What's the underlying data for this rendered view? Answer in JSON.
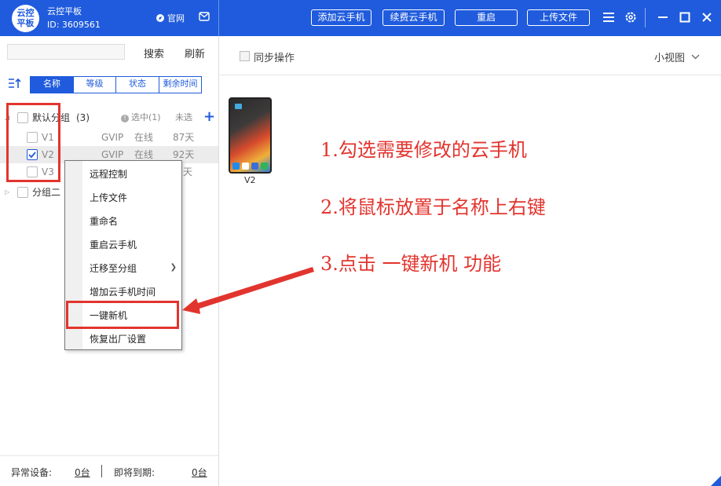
{
  "titlebar": {
    "logo_text": "云控\n平板",
    "app_name": "云控平板",
    "app_id": "ID: 3609561",
    "official_label": "官网",
    "buttons": [
      "添加云手机",
      "续费云手机",
      "重启",
      "上传文件"
    ]
  },
  "left_panel": {
    "search_label": "搜索",
    "refresh_label": "刷新",
    "tabs": [
      "名称",
      "等级",
      "状态",
      "剩余时间"
    ],
    "groups": [
      {
        "name": "默认分组",
        "count": "(3)",
        "selected_label": "选中(1)",
        "unselected_label": "未选",
        "devices": [
          {
            "name": "V1",
            "level": "GVIP",
            "status": "在线",
            "remaining": "87天",
            "checked": false
          },
          {
            "name": "V2",
            "level": "GVIP",
            "status": "在线",
            "remaining": "92天",
            "checked": true
          },
          {
            "name": "V3",
            "level": "",
            "status": "",
            "remaining": "天",
            "checked": false
          }
        ]
      },
      {
        "name": "分组二"
      }
    ],
    "footer": {
      "abnormal_label": "异常设备:",
      "abnormal_value": "0台",
      "expiring_label": "即将到期:",
      "expiring_value": "0台"
    }
  },
  "main": {
    "sync_label": "同步操作",
    "view_mode": "小视图",
    "device_label": "V2",
    "instructions": [
      "1.勾选需要修改的云手机",
      "2.将鼠标放置于名称上右键",
      "3.点击 一键新机 功能"
    ]
  },
  "context_menu": {
    "items": [
      "远程控制",
      "上传文件",
      "重命名",
      "重启云手机",
      "迁移至分组",
      "增加云手机时间",
      "一键新机",
      "恢复出厂设置"
    ]
  },
  "colors": {
    "accent": "#1f5bdc",
    "annotation": "#e2342e"
  }
}
